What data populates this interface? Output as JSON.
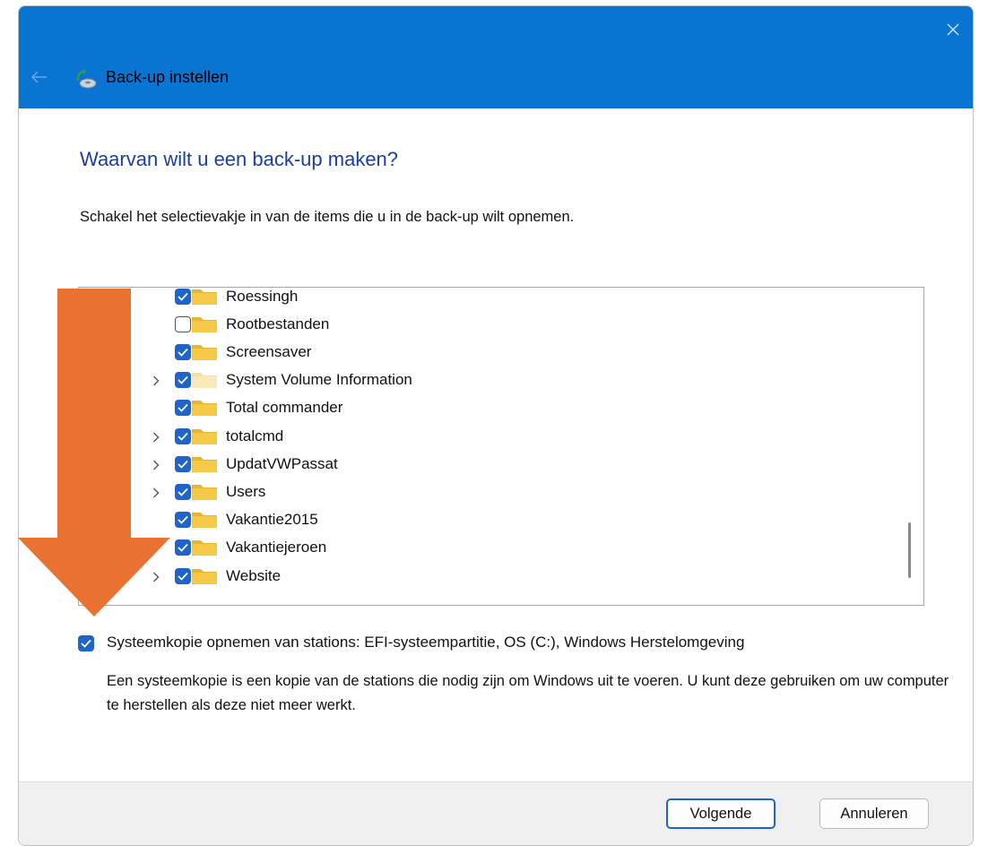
{
  "window": {
    "title": "Back-up instellen",
    "close_icon": "close-icon",
    "back_icon": "back-arrow-icon"
  },
  "content": {
    "heading": "Waarvan wilt u een back-up maken?",
    "instruction": "Schakel het selectievakje in van de items die u in de back-up wilt opnemen."
  },
  "tree": {
    "items": [
      {
        "label": "Roessingh",
        "checked": true,
        "expandable": false,
        "folder_style": "normal"
      },
      {
        "label": "Rootbestanden",
        "checked": false,
        "expandable": false,
        "folder_style": "normal"
      },
      {
        "label": "Screensaver",
        "checked": true,
        "expandable": false,
        "folder_style": "normal"
      },
      {
        "label": "System Volume Information",
        "checked": true,
        "expandable": true,
        "folder_style": "hidden"
      },
      {
        "label": "Total commander",
        "checked": true,
        "expandable": false,
        "folder_style": "normal"
      },
      {
        "label": "totalcmd",
        "checked": true,
        "expandable": true,
        "folder_style": "normal"
      },
      {
        "label": "UpdatVWPassat",
        "checked": true,
        "expandable": true,
        "folder_style": "normal"
      },
      {
        "label": "Users",
        "checked": true,
        "expandable": true,
        "folder_style": "normal"
      },
      {
        "label": "Vakantie2015",
        "checked": true,
        "expandable": false,
        "folder_style": "normal"
      },
      {
        "label": "Vakantiejeroen",
        "checked": true,
        "expandable": true,
        "folder_style": "normal"
      },
      {
        "label": "Website",
        "checked": true,
        "expandable": true,
        "folder_style": "normal"
      }
    ]
  },
  "system_image": {
    "checked": true,
    "label": "Systeemkopie opnemen van stations: EFI-systeempartitie, OS (C:), Windows Herstelomgeving",
    "description": "Een systeemkopie is een kopie van de stations die nodig zijn om Windows uit te voeren. U kunt deze gebruiken om uw computer te herstellen als deze niet meer werkt."
  },
  "buttons": {
    "next": "Volgende",
    "cancel": "Annuleren"
  },
  "colors": {
    "titlebar": "#0a74d2",
    "accent": "#1f65c9",
    "heading": "#1c3e9e",
    "annotation_arrow": "#e97132",
    "folder": "#f7c948"
  }
}
